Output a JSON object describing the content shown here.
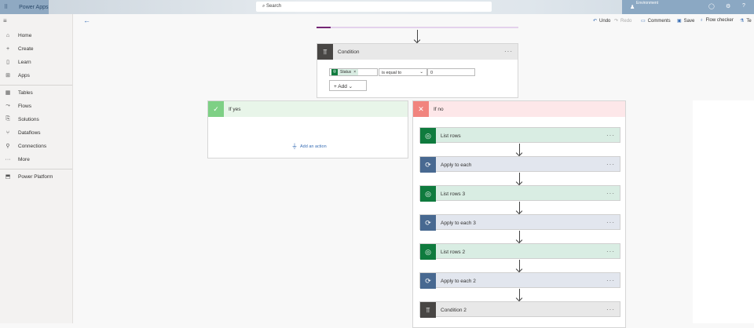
{
  "app": {
    "title": "Power Apps",
    "search_placeholder": "Search",
    "environment_label": "Environment"
  },
  "nav": {
    "items": [
      {
        "label": "Home",
        "icon": "⌂"
      },
      {
        "label": "Create",
        "icon": "+"
      },
      {
        "label": "Learn",
        "icon": "▯"
      },
      {
        "label": "Apps",
        "icon": "⊞"
      },
      {
        "label": "Tables",
        "icon": "▦"
      },
      {
        "label": "Flows",
        "icon": "⤳"
      },
      {
        "label": "Solutions",
        "icon": "⎘"
      },
      {
        "label": "Dataflows",
        "icon": "⑂"
      },
      {
        "label": "Connections",
        "icon": "⚲"
      },
      {
        "label": "More",
        "icon": "···"
      },
      {
        "label": "Power Platform",
        "icon": "⬒"
      }
    ]
  },
  "toolbar": {
    "undo": "Undo",
    "redo": "Redo",
    "comments": "Comments",
    "save": "Save",
    "flow_checker": "Flow checker",
    "test": "Te"
  },
  "condition": {
    "title": "Condition",
    "token": "Status",
    "operator": "is equal to",
    "value": "0",
    "add": "Add"
  },
  "if_yes": {
    "title": "If yes",
    "add_action": "Add an action"
  },
  "if_no": {
    "title": "If no",
    "steps": [
      {
        "title": "List rows",
        "kind": "dataverse"
      },
      {
        "title": "Apply to each",
        "kind": "loop"
      },
      {
        "title": "List rows 3",
        "kind": "dataverse"
      },
      {
        "title": "Apply to each 3",
        "kind": "loop"
      },
      {
        "title": "List rows 2",
        "kind": "dataverse"
      },
      {
        "title": "Apply to each 2",
        "kind": "loop"
      },
      {
        "title": "Condition 2",
        "kind": "condition"
      }
    ]
  },
  "colors": {
    "accent": "#742774",
    "dataverse": "#0f7b3e",
    "loop": "#486991",
    "condition": "#484644"
  }
}
